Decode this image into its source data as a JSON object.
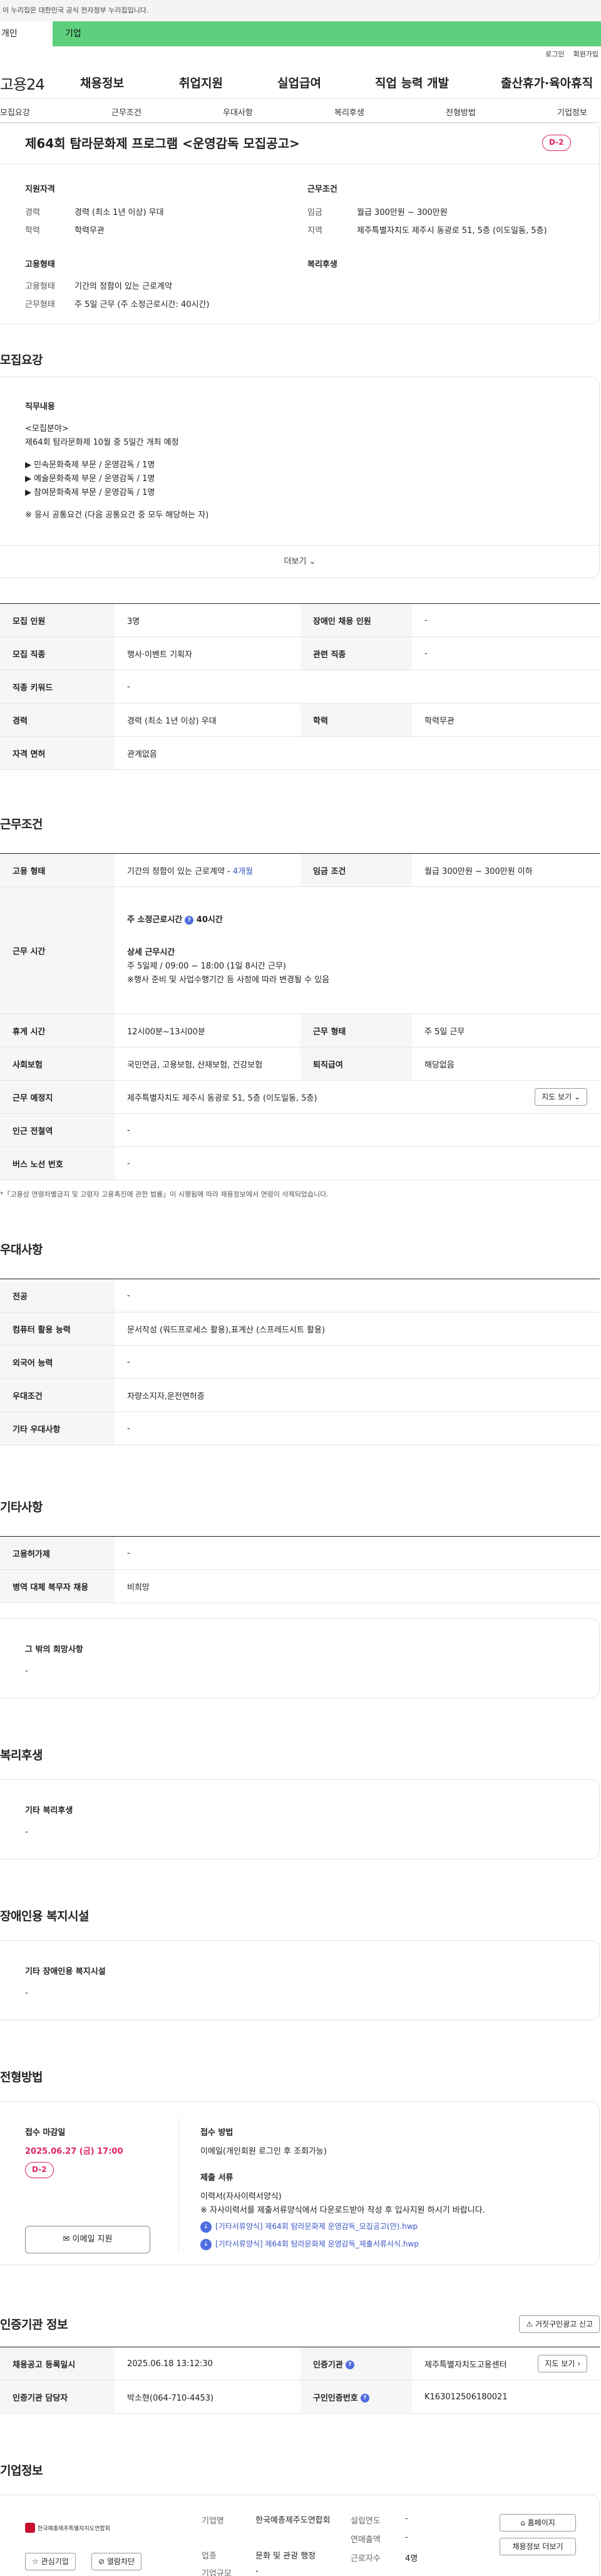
{
  "notice": "이 누리집은 대한민국 공식 전자정부 누리집입니다.",
  "user_tabs": {
    "personal": "개인",
    "company": "기업"
  },
  "util": {
    "login": "로그인",
    "signup": "회원가입"
  },
  "gnb": {
    "logo": "고용24",
    "menus": [
      "채용정보",
      "취업지원",
      "실업급여",
      "직업 능력 개발",
      "출산휴가·육아휴직"
    ]
  },
  "subtabs": [
    "모집요강",
    "근무조건",
    "우대사항",
    "복리후생",
    "전형방법",
    "기업정보"
  ],
  "header": {
    "title": "제64회 탐라문화제 프로그램 <운영감독 모집공고>",
    "dday": "D-2",
    "qual_title": "지원자격",
    "qual": [
      {
        "k": "경력",
        "v": "경력 (최소 1년 이상) 우대"
      },
      {
        "k": "학력",
        "v": "학력무관"
      }
    ],
    "cond_title": "근무조건",
    "cond": [
      {
        "k": "임금",
        "v": "월급 300만원 ~ 300만원"
      },
      {
        "k": "지역",
        "v": "제주특별자치도 제주시 동광로 51, 5층 (이도일동, 5층)"
      }
    ],
    "emp_title": "고용형태",
    "emp": [
      {
        "k": "고용형태",
        "v": "기간의 정함이 있는 근로계약"
      },
      {
        "k": "근무형태",
        "v": "주 5일 근무 (주 소정근로시간: 40시간)"
      }
    ],
    "welfare_title": "복리후생"
  },
  "recruit": {
    "title": "모집요강",
    "job_label": "직무내용",
    "lines": [
      "<모집분야>",
      "제64회 탐라문화제 10월 중 5일간 개최 예정",
      "▶ 민속문화축제 부문 / 운영감독 / 1명",
      "▶ 예술문화축제 부문 / 운영감독 / 1명",
      "▶ 참여문화축제 부문 / 운영감독 / 1명",
      "※ 응시 공통요건 (다음 공통요건 중 모두 해당하는 자)"
    ],
    "more": "더보기",
    "rows": [
      [
        "모집 인원",
        "3명",
        "장애인 채용 인원",
        "-"
      ],
      [
        "모집 직종",
        "행사·이벤트 기획자",
        "관련 직종",
        "-"
      ],
      [
        "직종 키워드",
        "-"
      ],
      [
        "경력",
        "경력 (최소 1년 이상) 우대",
        "학력",
        "학력무관"
      ],
      [
        "자격 면허",
        "관계없음"
      ]
    ]
  },
  "work": {
    "title": "근무조건",
    "emp_type_k": "고용 형태",
    "emp_type_v": "기간의 정함이 있는 근로계약 - ",
    "emp_type_link": "4개월",
    "wage_k": "임금 조건",
    "wage_v": "월급 300만원 ~ 300만원 이하",
    "time_k": "근무 시간",
    "time_main": "주 소정근로시간",
    "time_hours": "40시간",
    "time_sub": "상세 근무시간",
    "time_l1": "주 5일제 / 09:00 ~ 18:00 (1일 8시간 근무)",
    "time_l2": "※행사 준비 및 사업수행기간 등 사정에 따라 변경될 수 있음",
    "break_k": "휴게 시간",
    "break_v": "12시00분~13시00분",
    "form_k": "근무 형태",
    "form_v": "주 5일 근무",
    "ins_k": "사회보험",
    "ins_v": "국민연금, 고용보험, 산재보험, 건강보험",
    "sev_k": "퇴직급여",
    "sev_v": "해당없음",
    "place_k": "근무 예정지",
    "place_v": "제주특별자치도 제주시 동광로 51, 5층 (이도일동, 5층)",
    "map_btn": "지도 보기",
    "sub_k": "인근 전철역",
    "sub_v": "-",
    "bus_k": "버스 노선 번호",
    "bus_v": "-",
    "note": "*「고용상 연령차별금지 및 고령자 고용촉진에 관한 법률」이 시행됨에 따라 채용정보에서 연령이 삭제되었습니다."
  },
  "pref": {
    "title": "우대사항",
    "rows": [
      [
        "전공",
        "-"
      ],
      [
        "컴퓨터 활용 능력",
        "문서작성 (워드프로세스 활용),표계산 (스프레드시트 활용)"
      ],
      [
        "외국어 능력",
        "-"
      ],
      [
        "우대조건",
        "차량소지자,운전면허증"
      ],
      [
        "기타 우대사항",
        "-"
      ]
    ]
  },
  "etc": {
    "title": "기타사항",
    "rows": [
      [
        "고용허가제",
        "-"
      ],
      [
        "병역 대체 복무자 채용",
        "비희망"
      ]
    ],
    "wish_label": "그 밖의 희망사항",
    "wish_v": "-"
  },
  "welfare": {
    "title": "복리후생",
    "label": "기타 복리후생",
    "v": "-"
  },
  "disab": {
    "title": "장애인용 복지시설",
    "label": "기타 장애인용 복지시설",
    "v": "-"
  },
  "proc": {
    "title": "전형방법",
    "deadline_k": "접수 마감일",
    "deadline_v": "2025.06.27 (금) 17:00",
    "dday": "D-2",
    "email_btn": "이메일 지원",
    "method_k": "접수 방법",
    "method_v": "이메일(개인회원 로그인 후 조회가능)",
    "docs_k": "제출 서류",
    "docs_l1": "이력서(자사이력서양식)",
    "docs_l2": "※ 자사이력서를 제출서류양식에서 다운로드받아 작성 후 입사지원 하시기 바랍니다.",
    "files": [
      "[기타서류양식] 제64회 탐라문화제 운영감독_모집공고(안).hwp",
      "[기타서류양식] 제64회 탐라문화제 운영감독_제출서류서식.hwp"
    ]
  },
  "cert": {
    "title": "인증기관 정보",
    "report_btn": "거짓구인광고 신고",
    "rows": [
      [
        "채용공고 등록일시",
        "2025.06.18 13:12:30",
        "인증기관",
        "제주특별자치도고용센터"
      ],
      [
        "인증기관 담당자",
        "박소현(064-710-4453)",
        "구인인증번호",
        "K163012506180021"
      ]
    ],
    "map_btn": "지도 보기"
  },
  "company": {
    "title": "기업정보",
    "logo_text": "한국예총제주특별자치도연합회",
    "fav_btn": "관심기업",
    "block_btn": "열람차단",
    "name_k": "기업명",
    "name_v": "한국예총제주도연합회",
    "industry_k": "업종",
    "industry_v": "문화 및 관광 행정",
    "size_k": "기업규모",
    "size_v": "-",
    "founded_k": "설립연도",
    "founded_v": "-",
    "revenue_k": "연매출액",
    "revenue_v": "-",
    "staff_k": "근로자수",
    "staff_v": "4명",
    "home_btn": "홈페이지",
    "more_btn": "채용정보 더보기"
  }
}
